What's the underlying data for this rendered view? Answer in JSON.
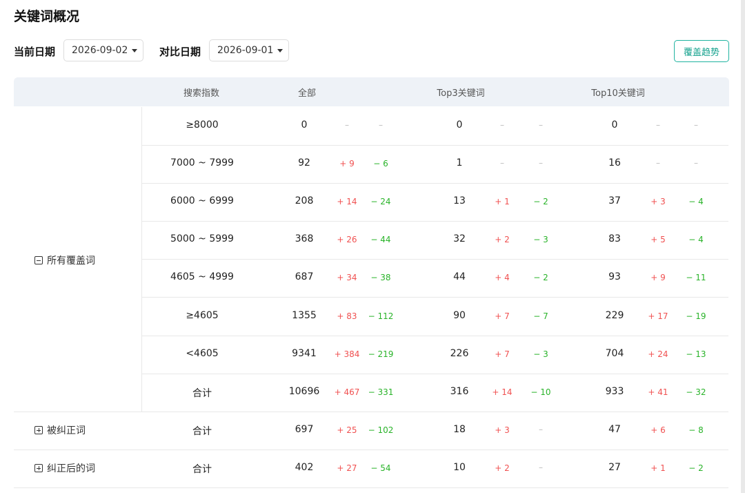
{
  "page": {
    "title": "关键词概况"
  },
  "filters": {
    "current_label": "当前日期",
    "current_value": "2026-09-02",
    "compare_label": "对比日期",
    "compare_value": "2026-09-01",
    "trend_button": "覆盖趋势"
  },
  "table": {
    "headers": {
      "search_index": "搜索指数",
      "all": "全部",
      "top3": "Top3关键词",
      "top10": "Top10关键词"
    },
    "groups": [
      {
        "label": "所有覆盖词",
        "expanded": true
      },
      {
        "label": "被纠正词",
        "expanded": false
      },
      {
        "label": "纠正后的词",
        "expanded": false
      }
    ],
    "rows": [
      {
        "range": "≥8000",
        "all": [
          "0",
          "–",
          "–"
        ],
        "top3": [
          "0",
          "–",
          "–"
        ],
        "top10": [
          "0",
          "–",
          "–"
        ]
      },
      {
        "range": "7000 ~ 7999",
        "all": [
          "92",
          "+ 9",
          "− 6"
        ],
        "top3": [
          "1",
          "–",
          "–"
        ],
        "top10": [
          "16",
          "–",
          "–"
        ]
      },
      {
        "range": "6000 ~ 6999",
        "all": [
          "208",
          "+ 14",
          "− 24"
        ],
        "top3": [
          "13",
          "+ 1",
          "− 2"
        ],
        "top10": [
          "37",
          "+ 3",
          "− 4"
        ]
      },
      {
        "range": "5000 ~ 5999",
        "all": [
          "368",
          "+ 26",
          "− 44"
        ],
        "top3": [
          "32",
          "+ 2",
          "− 3"
        ],
        "top10": [
          "83",
          "+ 5",
          "− 4"
        ]
      },
      {
        "range": "4605 ~ 4999",
        "all": [
          "687",
          "+ 34",
          "− 38"
        ],
        "top3": [
          "44",
          "+ 4",
          "− 2"
        ],
        "top10": [
          "93",
          "+ 9",
          "− 11"
        ]
      },
      {
        "range": "≥4605",
        "all": [
          "1355",
          "+ 83",
          "− 112"
        ],
        "top3": [
          "90",
          "+ 7",
          "− 7"
        ],
        "top10": [
          "229",
          "+ 17",
          "− 19"
        ]
      },
      {
        "range": "<4605",
        "all": [
          "9341",
          "+ 384",
          "− 219"
        ],
        "top3": [
          "226",
          "+ 7",
          "− 3"
        ],
        "top10": [
          "704",
          "+ 24",
          "− 13"
        ]
      },
      {
        "range": "合计",
        "all": [
          "10696",
          "+ 467",
          "− 331"
        ],
        "top3": [
          "316",
          "+ 14",
          "− 10"
        ],
        "top10": [
          "933",
          "+ 41",
          "− 32"
        ]
      },
      {
        "range": "合计",
        "all": [
          "697",
          "+ 25",
          "− 102"
        ],
        "top3": [
          "18",
          "+ 3",
          "–"
        ],
        "top10": [
          "47",
          "+ 6",
          "− 8"
        ]
      },
      {
        "range": "合计",
        "all": [
          "402",
          "+ 27",
          "− 54"
        ],
        "top3": [
          "10",
          "+ 2",
          "–"
        ],
        "top10": [
          "27",
          "+ 1",
          "− 2"
        ]
      }
    ]
  }
}
